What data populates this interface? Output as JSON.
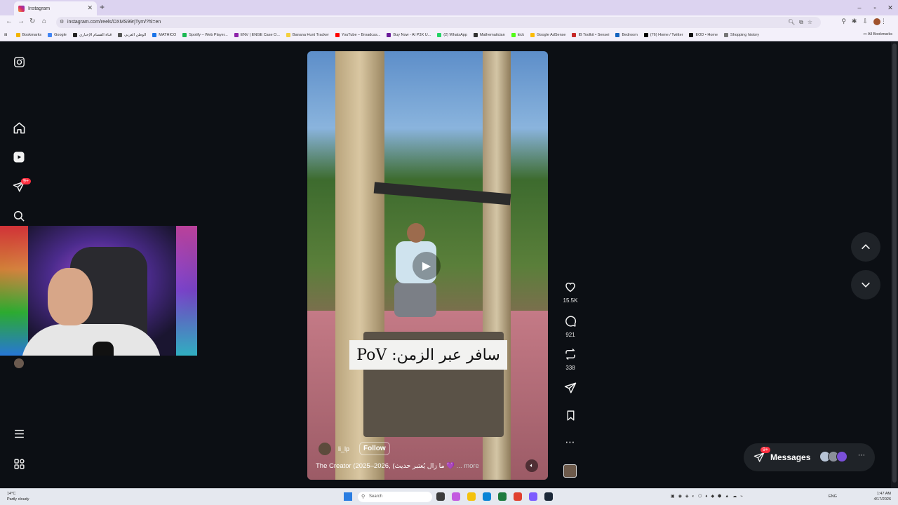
{
  "browser": {
    "tab_title": "Instagram",
    "new_tab": "+",
    "url": "instagram.com/reels/DXMS99rjTym/?hl=en",
    "window_controls": [
      "–",
      "▫",
      "✕"
    ],
    "bookmarks": [
      "Bookmarks",
      "Google",
      "قناة القسام الإخباري",
      "الوطن العربي",
      "MATHICO",
      "Spotify – Web Player...",
      "ENV | ENGE Case O...",
      "Banana Hunt Tracker",
      "YouTube – Broadcas...",
      "Buy Now - AI P3X U...",
      "(2) WhatsApp",
      "Mathematician",
      "kick",
      "Google AdSense",
      "IB Toolkit • Sensei",
      "Bedroom",
      "(76) Home / Twitter",
      "EOD • Home",
      "Shopping history"
    ],
    "all_bookmarks": "All Bookmarks"
  },
  "sidebar": {
    "notifications_badge": "9+"
  },
  "reel": {
    "caption_overlay": "سافر عبر الزمن: PoV",
    "author": "li_lp",
    "follow_label": "Follow",
    "description": "The Creator (2025–2026, (ما زال يُعتبر حديث 💜",
    "more_label": "... more"
  },
  "actions": {
    "likes": "15.5K",
    "comments": "921",
    "reposts": "338"
  },
  "messages": {
    "label": "Messages",
    "badge": "9+"
  },
  "taskbar": {
    "weather_temp": "14°C",
    "weather_desc": "Partly cloudy",
    "search_placeholder": "Search",
    "lang": "ENG",
    "time": "1:47 AM",
    "date": "4/17/2026"
  },
  "colors": {
    "background": "#0c0f14",
    "badge_red": "#ff3040",
    "tabbar": "#dcd3f0"
  }
}
